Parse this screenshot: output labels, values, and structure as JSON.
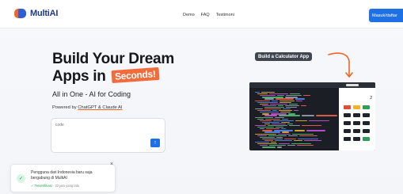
{
  "header": {
    "brand": "MultiAI",
    "nav": [
      "Demo",
      "FAQ",
      "Testimoni"
    ],
    "login_label": "Masuk/daftar"
  },
  "hero": {
    "title_line1": "Build Your Dream",
    "title_line2_prefix": "Apps in",
    "title_highlight": "Seconds!",
    "tagline": "All in One - AI for Coding",
    "powered_prefix": "Powered by",
    "powered_links": "ChatGPT & Claude AI"
  },
  "prompt": {
    "placeholder": "code",
    "send_icon": "arrow-up-icon"
  },
  "demo": {
    "label": "Build a Calculator App",
    "calc_display": "2"
  },
  "toast": {
    "line1": "Pengguna dari Indonesia baru saja",
    "line2": "bergabung di MultiAI",
    "verified": "Terverifikasi",
    "time": "22 jam yang lalu",
    "close": "×"
  },
  "colors": {
    "accent": "#1f6fe5",
    "brand_orange": "#f26522",
    "brand_navy": "#1d3a8a",
    "success": "#1aa35a"
  }
}
